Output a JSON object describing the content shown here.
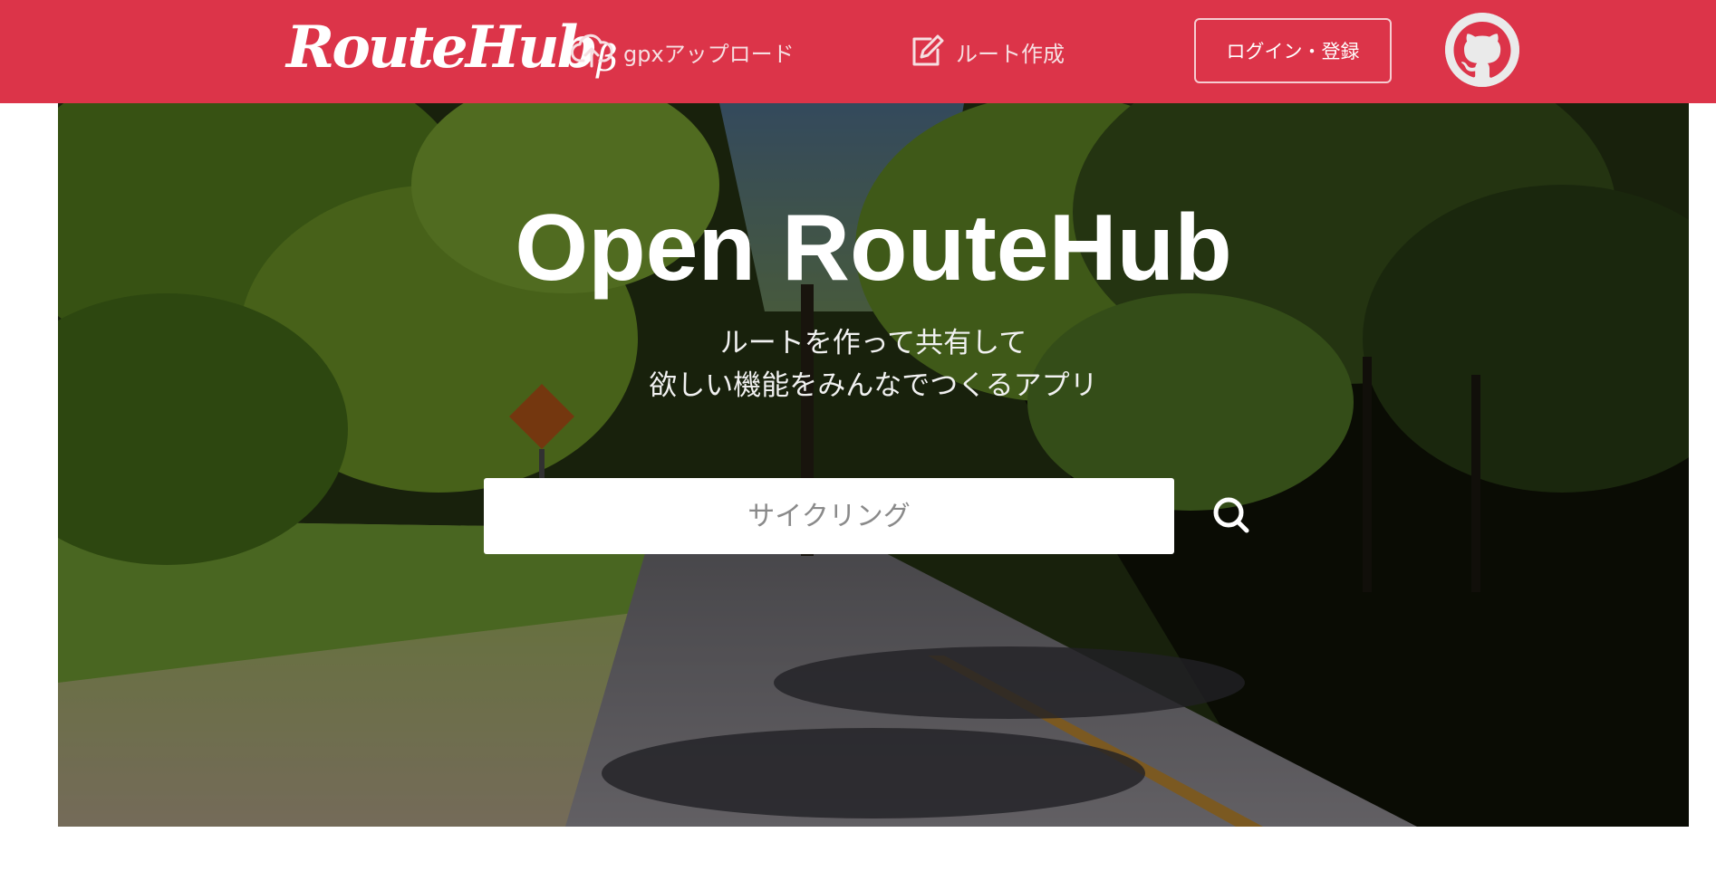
{
  "header": {
    "logo_text": "RouteHub",
    "logo_beta": "β",
    "brand_color": "#dc3449",
    "nav": {
      "upload_label": "gpxアップロード",
      "upload_icon": "cloud-upload-icon",
      "create_label": "ルート作成",
      "create_icon": "edit-icon"
    },
    "login_label": "ログイン・登録",
    "github_icon": "github-icon"
  },
  "hero": {
    "title": "Open RouteHub",
    "subtitle_line1": "ルートを作って共有して",
    "subtitle_line2": "欲しい機能をみんなでつくるアプリ",
    "background": "forest road photo",
    "search": {
      "placeholder": "サイクリング",
      "value": "",
      "button_icon": "search-icon"
    }
  }
}
